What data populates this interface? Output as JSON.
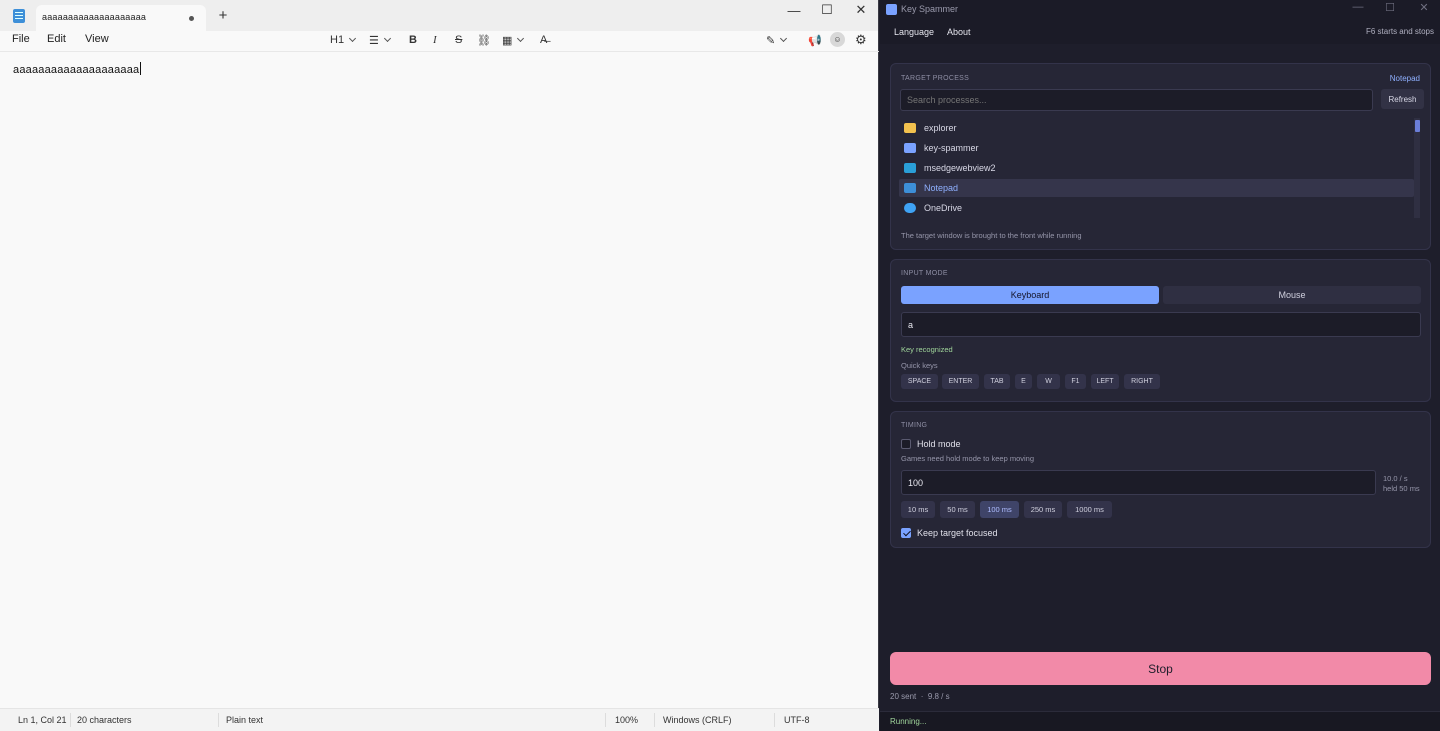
{
  "notepad": {
    "tab_title": "aaaaaaaaaaaaaaaaaaaa",
    "new_tab": "+",
    "win_controls": {
      "minimize": "—",
      "maximize": "☐",
      "close": "✕"
    },
    "menu": [
      "File",
      "Edit",
      "View"
    ],
    "toolbar": {
      "heading": "H1",
      "list": "☰",
      "bold": "B",
      "italic": "I",
      "strike": "S",
      "link": "⛓",
      "table": "▦",
      "clear_format": "A̶"
    },
    "editor_text": "aaaaaaaaaaaaaaaaaaaa",
    "status": {
      "position": "Ln 1, Col 21",
      "characters": "20 characters",
      "format": "Plain text",
      "zoom": "100%",
      "line_ending": "Windows (CRLF)",
      "encoding": "UTF-8"
    }
  },
  "key_spammer": {
    "title": "Key Spammer",
    "win_controls": {
      "minimize": "—",
      "maximize": "☐",
      "close": "✕"
    },
    "menu": [
      "Language",
      "About"
    ],
    "hotkey_hint": "F6 starts and stops",
    "target": {
      "label": "TARGET PROCESS",
      "selected": "Notepad",
      "search_placeholder": "Search processes...",
      "refresh": "Refresh",
      "processes": [
        {
          "name": "explorer",
          "color": "#f2c14e"
        },
        {
          "name": "key-spammer",
          "color": "#7aa2ff"
        },
        {
          "name": "msedgewebview2",
          "color": "#2a9fd8"
        },
        {
          "name": "Notepad",
          "color": "#3d8fd8"
        },
        {
          "name": "OneDrive",
          "color": "#3fa3f5"
        }
      ],
      "note": "The target window is brought to the front while running"
    },
    "input_mode": {
      "label": "INPUT MODE",
      "keyboard": "Keyboard",
      "mouse": "Mouse",
      "active": "Keyboard",
      "key_value": "a",
      "key_status": "Key recognized",
      "quick_keys_label": "Quick keys",
      "quick_keys": [
        "SPACE",
        "ENTER",
        "TAB",
        "E",
        "W",
        "F1",
        "LEFT",
        "RIGHT"
      ]
    },
    "timing": {
      "label": "TIMING",
      "hold_mode": "Hold mode",
      "hold_mode_checked": false,
      "hold_note": "Games need hold mode to keep moving",
      "interval_value": "100",
      "rate": "10.0 / s",
      "held": "held 50 ms",
      "presets": [
        "10 ms",
        "50 ms",
        "100 ms",
        "250 ms",
        "1000 ms"
      ],
      "active_preset": "100 ms",
      "keep_focused": "Keep target focused",
      "keep_focused_checked": true
    },
    "stop_button": "Stop",
    "stats_sent": "20 sent",
    "stats_dot": "·",
    "stats_rate": "9.8 / s",
    "status": "Running..."
  },
  "colors": {
    "accent": "#7aa2ff",
    "stop": "#f28aa8",
    "running": "#9fd49a"
  }
}
